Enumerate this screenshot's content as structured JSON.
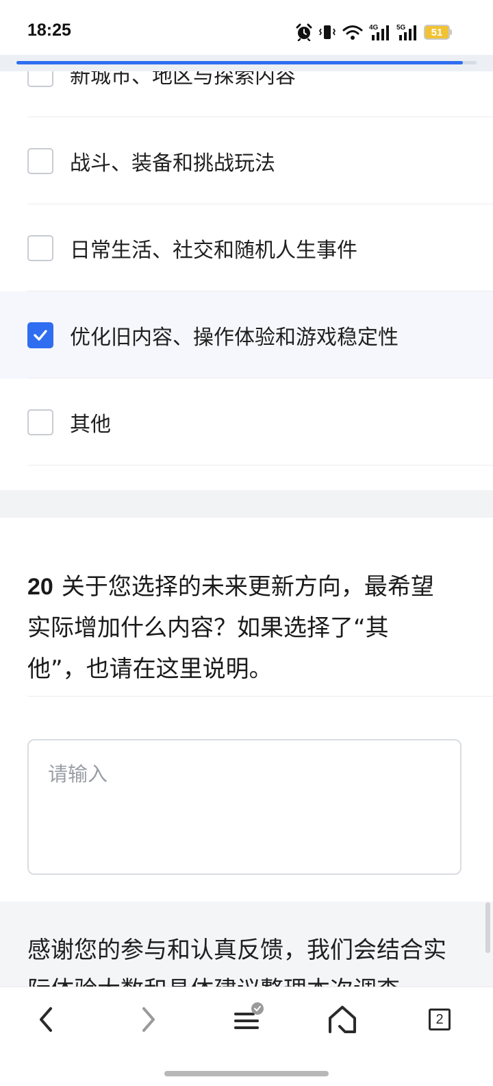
{
  "status_bar": {
    "time": "18:25",
    "signal_4g": "4G",
    "signal_5g": "5G",
    "battery": "51",
    "icons": [
      "alarm-icon",
      "vibrate-icon",
      "wifi-icon",
      "signal-4g-icon",
      "signal-5g-icon",
      "battery-icon"
    ]
  },
  "progress": {
    "fraction": 0.97
  },
  "options": [
    {
      "label": "新城市、地区与探索内容",
      "checked": false
    },
    {
      "label": "战斗、装备和挑战玩法",
      "checked": false
    },
    {
      "label": "日常生活、社交和随机人生事件",
      "checked": false
    },
    {
      "label": "优化旧内容、操作体验和游戏稳定性",
      "checked": true
    },
    {
      "label": "其他",
      "checked": false
    }
  ],
  "question": {
    "number": "20",
    "text": "关于您选择的未来更新方向，最希望实际增加什么内容？如果选择了“其他”，也请在这里说明。"
  },
  "answer": {
    "placeholder": "请输入",
    "value": ""
  },
  "footer": {
    "text": "感谢您的参与和认真反馈，我们会结合实际体验大数和具体建议整理本次调查"
  },
  "bottom_nav": {
    "tab_count": "2",
    "icons": [
      "back-icon",
      "forward-icon",
      "menu-icon",
      "home-icon",
      "tabs-icon"
    ]
  },
  "colors": {
    "accent": "#2f6ef0",
    "selected_row": "#f5f7fc",
    "battery": "#f1c232"
  }
}
